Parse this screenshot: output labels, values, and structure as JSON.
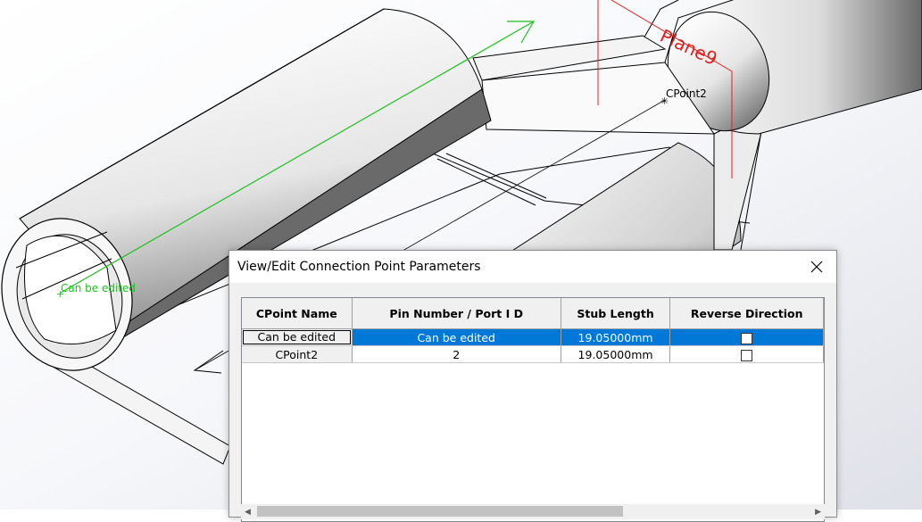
{
  "viewport": {
    "cpoint_label_1": "Can be edited",
    "cpoint_label_2": "CPoint2",
    "plane_label": "Plane9",
    "colors": {
      "green": "#1cc21c",
      "red": "#e02020"
    }
  },
  "dialog": {
    "title": "View/Edit Connection Point Parameters",
    "close_icon": "close-icon",
    "columns": [
      "CPoint Name",
      "Pin Number / Port I D",
      "Stub Length",
      "Reverse Direction"
    ],
    "rows": [
      {
        "name": "Can be edited",
        "pin": "Can be edited",
        "stub": "19.05000mm",
        "reverse": false
      },
      {
        "name": "CPoint2",
        "pin": "2",
        "stub": "19.05000mm",
        "reverse": false
      }
    ],
    "selection_color": "#0078d7"
  }
}
